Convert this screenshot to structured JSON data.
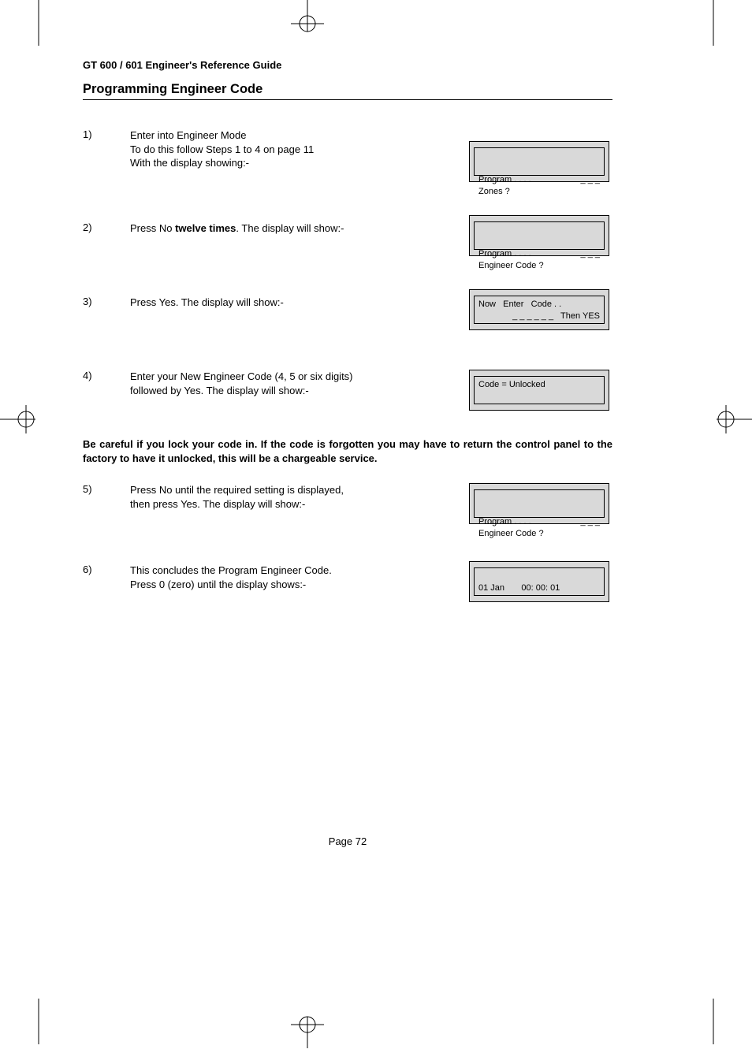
{
  "header": "GT 600 / 601 Engineer's Reference Guide",
  "section_title": "Programming Engineer Code",
  "steps": {
    "s1": {
      "num": "1)",
      "line1": "Enter into Engineer Mode",
      "line2": "To do this follow Steps 1 to 4 on page 11",
      "line3": "With the display showing:-",
      "disp_l1_left": "Program . . . .",
      "disp_l1_right": "_ _ _",
      "disp_l2": "Zones ?"
    },
    "s2": {
      "num": "2)",
      "text_before": "Press No ",
      "text_bold": "twelve times",
      "text_after": ". The display will show:-",
      "disp_l1_left": "Program . . . .",
      "disp_l1_right": "_ _ _",
      "disp_l2": "Engineer Code ?"
    },
    "s3": {
      "num": "3)",
      "text": "Press Yes. The display will show:-",
      "disp_l1": "Now   Enter   Code . .",
      "disp_l2": "_ _ _ _ _ _   Then YES"
    },
    "s4": {
      "num": "4)",
      "line1": "Enter your New Engineer Code (4, 5 or six digits)",
      "line2": "followed by Yes. The display will show:-",
      "disp_l1": "Code = Unlocked",
      "disp_l2": ""
    },
    "s5": {
      "num": "5)",
      "line1": "Press No until the required setting is displayed,",
      "line2": "then press Yes. The display will show:-",
      "disp_l1_left": "Program . . . .",
      "disp_l1_right": "_ _ _",
      "disp_l2": "Engineer Code ?"
    },
    "s6": {
      "num": "6)",
      "line1": "This concludes the Program Engineer Code.",
      "line2": "Press 0 (zero) until the display shows:-",
      "disp_l1": "",
      "disp_l2": "01 Jan       00: 00: 01"
    }
  },
  "warning": "Be careful if you lock your code in. If the code is forgotten you may have to return the control panel to the factory to have it unlocked, this will be a chargeable service.",
  "page_number": "Page  72"
}
